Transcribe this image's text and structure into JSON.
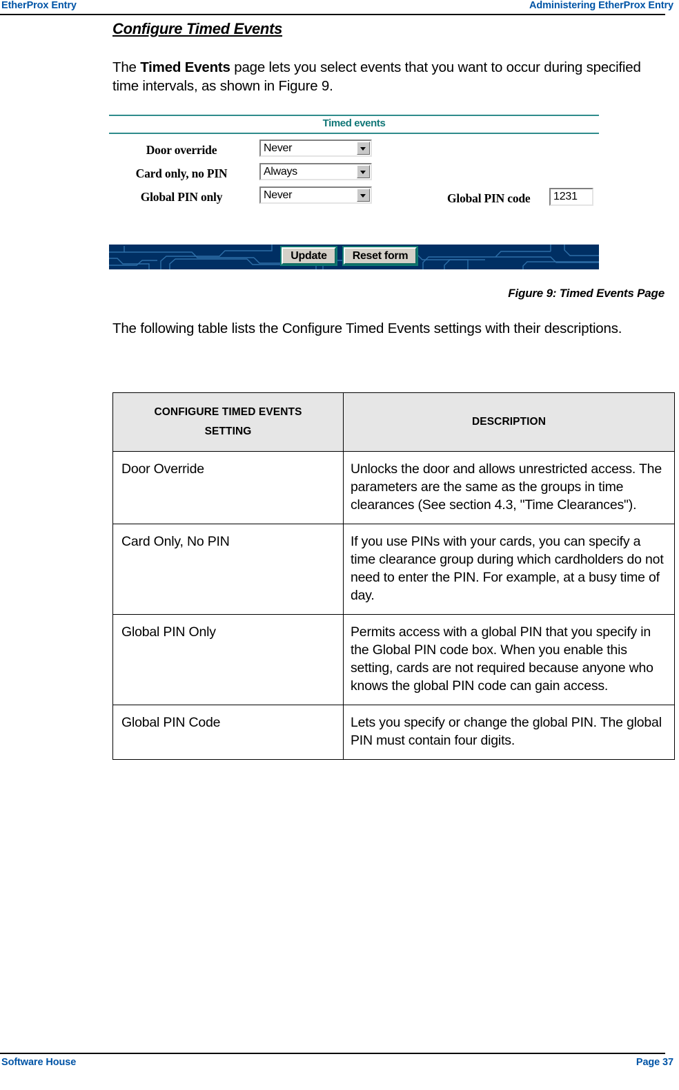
{
  "header": {
    "left": "EtherProx Entry",
    "right": "Administering EtherProx Entry"
  },
  "footer": {
    "left": "Software House",
    "right": "Page 37"
  },
  "section": {
    "heading": "Configure Timed Events",
    "intro_before": "The ",
    "intro_bold": "Timed Events",
    "intro_after": " page lets you select events that you want to occur during specified time intervals, as shown in Figure 9.",
    "table_intro": "The following table lists the Configure Timed Events settings with their descriptions."
  },
  "figure": {
    "caption": "Figure 9: Timed Events Page",
    "title": "Timed events",
    "rows": [
      {
        "label": "Door override",
        "value": "Never"
      },
      {
        "label": "Card only, no PIN",
        "value": "Always"
      },
      {
        "label": "Global PIN only",
        "value": "Never"
      }
    ],
    "pin": {
      "label": "Global PIN code",
      "value": "1231"
    },
    "buttons": {
      "update": "Update",
      "reset": "Reset form"
    },
    "colors": {
      "title_teal": "#117777",
      "rule_teal": "#2E8B8B",
      "bar_navy": "#002F63",
      "bar_trace": "#2E6FA8",
      "button_bevel": "#0f7a70"
    }
  },
  "table": {
    "headers": {
      "setting": "CONFIGURE TIMED EVENTS SETTING",
      "setting_line1": "CONFIGURE TIMED EVENTS",
      "setting_line2": "SETTING",
      "description": "DESCRIPTION"
    },
    "rows": [
      {
        "setting": "Door Override",
        "description": "Unlocks the door and allows unrestricted access. The parameters are the same as the groups in time clearances (See section 4.3, \"Time Clearances\")."
      },
      {
        "setting": "Card Only, No PIN",
        "description": "If you use PINs with your cards, you can specify a time clearance group during which cardholders do not need to enter the PIN. For example, at a busy time of day."
      },
      {
        "setting": "Global PIN Only",
        "description": "Permits access with a global PIN that you specify in the Global PIN code box. When you enable this setting, cards are not required because anyone who knows the global PIN code can gain access."
      },
      {
        "setting": "Global PIN Code",
        "description": "Lets you specify or change the global PIN. The global PIN must contain four digits."
      }
    ]
  },
  "theme": {
    "header_blue": "#0054A6",
    "table_header_bg": "#E6E6E6"
  }
}
